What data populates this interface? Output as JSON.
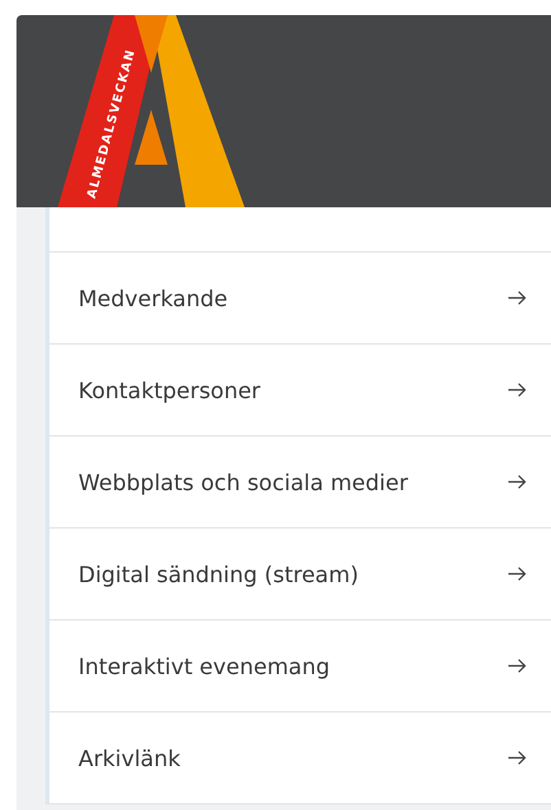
{
  "header": {
    "logo_text": "ALMEDALSVECKAN"
  },
  "menu": [
    {
      "label": "Medverkande"
    },
    {
      "label": "Kontaktpersoner"
    },
    {
      "label": "Webbplats och sociala medier"
    },
    {
      "label": "Digital sändning (stream)"
    },
    {
      "label": "Interaktivt evenemang"
    },
    {
      "label": "Arkivlänk"
    }
  ]
}
